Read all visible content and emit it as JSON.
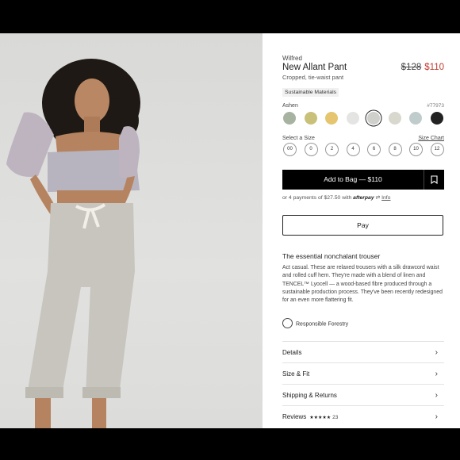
{
  "product": {
    "brand": "Wilfred",
    "name": "New Allant Pant",
    "subtitle": "Cropped, tie-waist pant",
    "price_old": "$128",
    "price_new": "$110",
    "tag": "Sustainable Materials"
  },
  "color": {
    "label": "Ashen",
    "sku": "#77973",
    "swatches": [
      {
        "name": "sage",
        "hex": "#a7b3a0"
      },
      {
        "name": "olive",
        "hex": "#c9c07a"
      },
      {
        "name": "mustard",
        "hex": "#e5c56f"
      },
      {
        "name": "pale-gray",
        "hex": "#e4e5e3"
      },
      {
        "name": "ashen",
        "hex": "#cfcfcc",
        "selected": true
      },
      {
        "name": "stone",
        "hex": "#d9d8ce"
      },
      {
        "name": "sea-glass",
        "hex": "#bfcccb"
      },
      {
        "name": "black",
        "hex": "#222222"
      }
    ]
  },
  "size": {
    "label": "Select a Size",
    "chart_link": "Size Chart",
    "options": [
      "00",
      "0",
      "2",
      "4",
      "6",
      "8",
      "10",
      "12"
    ]
  },
  "actions": {
    "add_to_bag": "Add to Bag — $110",
    "wishlist_icon": "bookmark-icon",
    "afterpay_prefix": "or 4 payments of $27.50 with",
    "afterpay_brand": "afterpay",
    "afterpay_info": "Info",
    "apple_pay": "Pay"
  },
  "description": {
    "heading": "The essential nonchalant trouser",
    "body": "Act casual. These are relaxed trousers with a silk drawcord waist and rolled cuff hem. They're made with a blend of linen and TENCEL™ Lyocell — a wood-based fibre produced through a sustainable production process. They've been recently redesigned for an even more flattering fit.",
    "forestry": "Responsible Forestry"
  },
  "accordion": [
    {
      "label": "Details"
    },
    {
      "label": "Size & Fit"
    },
    {
      "label": "Shipping & Returns"
    },
    {
      "label": "Reviews",
      "stars": "★★★★★",
      "count": "23"
    }
  ]
}
